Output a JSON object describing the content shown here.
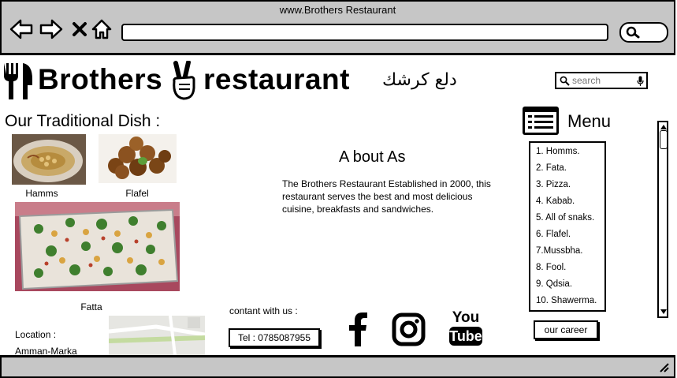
{
  "browser": {
    "url_title": "www.Brothers Restaurant"
  },
  "header": {
    "brand_word1": "Brothers",
    "brand_word2": "restaurant",
    "arabic_name": "دلع كرشك",
    "search_placeholder": "search"
  },
  "dishes": {
    "section_title": "Our Traditional Dish :",
    "items": [
      {
        "label": "Hamms"
      },
      {
        "label": "Flafel"
      },
      {
        "label": "Fatta"
      }
    ]
  },
  "about": {
    "title": "A bout As",
    "body": "The Brothers Restaurant Established in 2000, this restaurant serves the best and most delicious cuisine, breakfasts and sandwiches."
  },
  "menu": {
    "title": "Menu",
    "items": [
      "1. Homms.",
      "2. Fata.",
      "3. Pizza.",
      "4. Kabab.",
      "5. All of snaks.",
      "6. Flafel.",
      "7.Mussbha.",
      "8. Fool.",
      "9. Qdsia.",
      "10. Shawerma."
    ],
    "career_label": "our career"
  },
  "contact": {
    "title": "contant with us :",
    "tel": "Tel :  0785087955",
    "location_label": "Location :",
    "location_value": "Amman-Marka"
  },
  "social": {
    "youtube_top": "You",
    "youtube_bottom": "Tube"
  }
}
